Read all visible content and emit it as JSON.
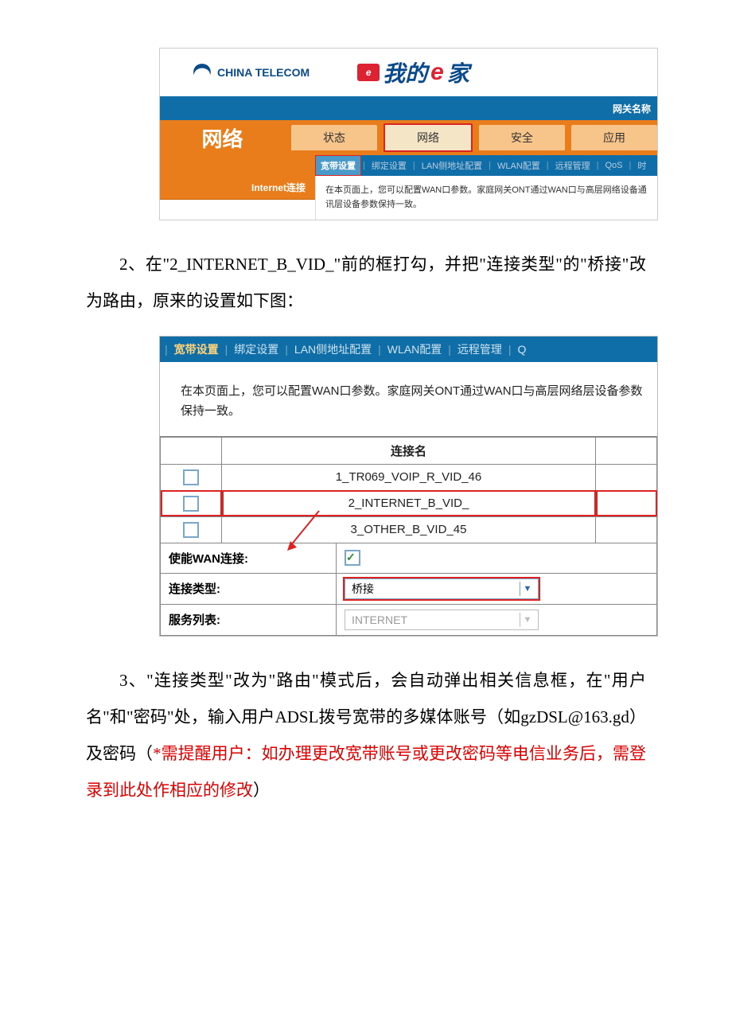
{
  "fig1": {
    "logo_sub": "CHINA TELECOM",
    "ehome_text": "我的",
    "ehome_e": "e",
    "ehome_tail": "家",
    "ehome_badge": "e",
    "status_right": "网关名称",
    "left_title": "网络",
    "tabs": [
      "状态",
      "网络",
      "安全",
      "应用"
    ],
    "selected_tab_index": 1,
    "subtabs": [
      "宽带设置",
      "绑定设置",
      "LAN侧地址配置",
      "WLAN配置",
      "远程管理",
      "QoS",
      "时"
    ],
    "subtabs_active_index": 0,
    "sidebar_item": "Internet连接",
    "content_text": "在本页面上，您可以配置WAN口参数。家庭网关ONT通过WAN口与高层网络设备通讯层设备参数保持一致。"
  },
  "para2": "2、在\"2_INTERNET_B_VID_\"前的框打勾，并把\"连接类型\"的\"桥接\"改为路由，原来的设置如下图：",
  "fig2": {
    "tabs": [
      "宽带设置",
      "绑定设置",
      "LAN侧地址配置",
      "WLAN配置",
      "远程管理",
      "Q"
    ],
    "active_tab_index": 0,
    "desc": "在本页面上，您可以配置WAN口参数。家庭网关ONT通过WAN口与高层网络层设备参数保持一致。",
    "table_header": "连接名",
    "rows": [
      {
        "checked": false,
        "name": "1_TR069_VOIP_R_VID_46",
        "highlight": false
      },
      {
        "checked": false,
        "name": "2_INTERNET_B_VID_",
        "highlight": true
      },
      {
        "checked": false,
        "name": "3_OTHER_B_VID_45",
        "highlight": false
      }
    ],
    "enable_label": "使能WAN连接:",
    "enable_checked": true,
    "conn_type_label": "连接类型:",
    "conn_type_value": "桥接",
    "service_label": "服务列表:",
    "service_value": "INTERNET"
  },
  "para3_a": "3、\"连接类型\"改为\"路由\"模式后，会自动弹出相关信息框，在\"用户名\"和\"密码\"处，输入用户ADSL拨号宽带的多媒体账号（如gzDSL@163.gd）及密码（",
  "para3_red": "*需提醒用户：如办理更改宽带账号或更改密码等电信业务后，需登录到此处作相应的修改",
  "para3_c": "）"
}
